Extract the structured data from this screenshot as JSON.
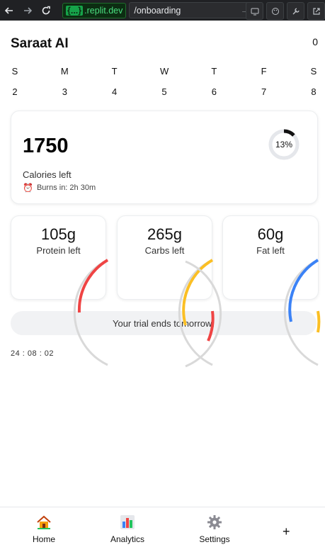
{
  "browser": {
    "domain_badge": "{...}",
    "domain_text": ".replit.dev",
    "path": "/onboarding"
  },
  "header": {
    "title": "Saraat AI",
    "count": "0"
  },
  "week": {
    "days": [
      "S",
      "M",
      "T",
      "W",
      "T",
      "F",
      "S"
    ],
    "dates": [
      "2",
      "3",
      "4",
      "5",
      "6",
      "7",
      "8"
    ]
  },
  "calories": {
    "value": "1750",
    "label": "Calories left",
    "burn_text": "Burns in: 2h 30m",
    "progress_percent": 13,
    "progress_label": "13%"
  },
  "macros": [
    {
      "value": "105g",
      "label": "Protein left",
      "color": "#ef4444"
    },
    {
      "value": "265g",
      "label": "Carbs left",
      "color": "#fbbf24"
    },
    {
      "value": "60g",
      "label": "Fat left",
      "color": "#3b82f6"
    }
  ],
  "trial": {
    "text": "Your trial ends tomorrow!",
    "timer": "24 : 08 : 02"
  },
  "tabs": [
    {
      "label": "Home",
      "icon": "house-icon"
    },
    {
      "label": "Analytics",
      "icon": "bar-chart-icon"
    },
    {
      "label": "Settings",
      "icon": "gear-icon"
    }
  ],
  "plus_label": "+"
}
